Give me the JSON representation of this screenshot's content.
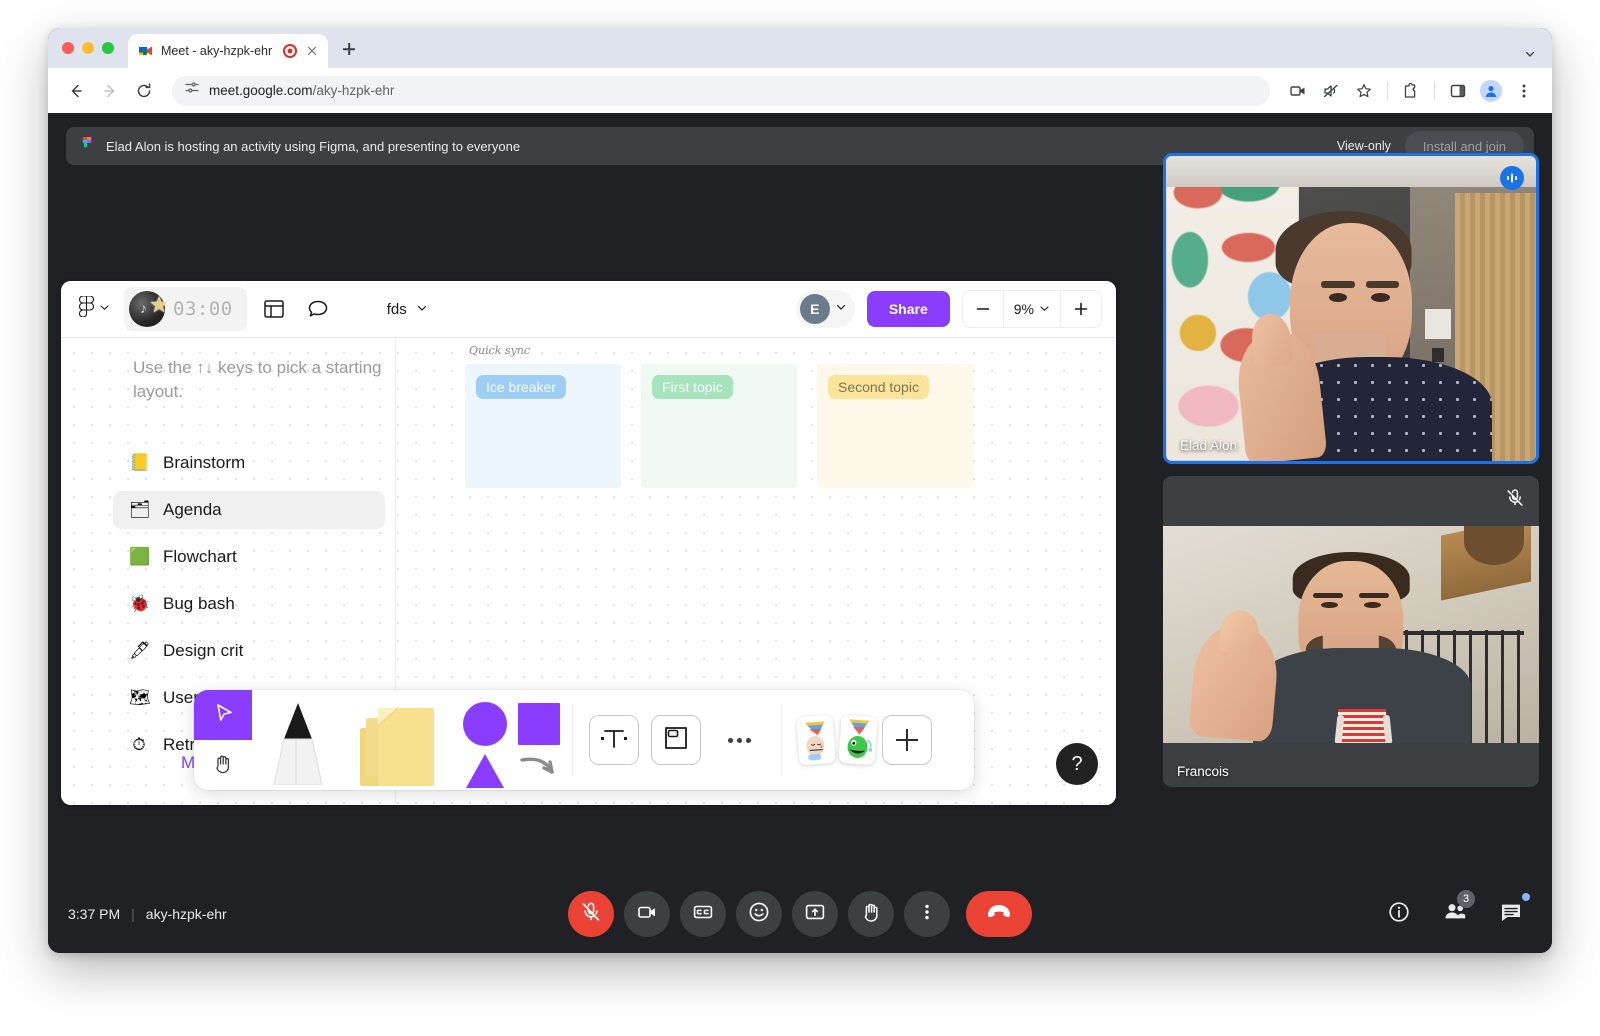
{
  "browser": {
    "tab": {
      "title": "Meet - aky-hzpk-ehr",
      "favicon_icon": "google-meet-favicon",
      "recording_icon": "recording-indicator-icon",
      "close_icon": "close-icon"
    },
    "newtab_icon": "new-tab-icon",
    "tabstrip_caret_icon": "chevron-down-icon",
    "nav": {
      "back_icon": "back-arrow-icon",
      "forward_icon": "forward-arrow-icon",
      "reload_icon": "reload-icon"
    },
    "omnibox": {
      "site_settings_icon": "page-info-icon",
      "url_host": "meet.google.com",
      "url_path": "/aky-hzpk-ehr"
    },
    "actions": [
      {
        "name": "screen-share-icon"
      },
      {
        "name": "mute-tab-icon"
      },
      {
        "name": "bookmark-star-icon"
      },
      {
        "name": "extensions-puzzle-icon"
      },
      {
        "name": "side-panel-icon"
      },
      {
        "name": "profile-avatar-icon"
      },
      {
        "name": "more-menu-icon"
      }
    ]
  },
  "banner": {
    "app_icon": "figma-logo-icon",
    "text": "Elad Alon is hosting an activity using Figma, and presenting to everyone",
    "view_only_label": "View-only",
    "install_button_label": "Install and join"
  },
  "figma": {
    "topbar": {
      "menu_icon": "figma-menu-icon",
      "menu_caret_icon": "chevron-down-icon",
      "timer_value": "03:00",
      "timer_badge_icon": "music-star-badge-icon",
      "layout_grid_icon": "layout-grid-icon",
      "comment_icon": "comment-bubble-icon",
      "file_name": "fds",
      "file_caret_icon": "chevron-down-icon",
      "avatar_initial": "E",
      "avatar_caret_icon": "chevron-down-icon",
      "share_label": "Share",
      "zoom_out_icon": "minus-icon",
      "zoom_value": "9%",
      "zoom_caret_icon": "chevron-down-icon",
      "zoom_in_icon": "plus-icon"
    },
    "canvas": {
      "hint": "Use the ↑↓ keys to pick a starting layout.",
      "layouts": [
        {
          "emoji": "📒",
          "label": "Brainstorm",
          "active": false
        },
        {
          "emoji": "🗂",
          "label": "Agenda",
          "active": true
        },
        {
          "emoji": "🟩",
          "label": "Flowchart",
          "active": false
        },
        {
          "emoji": "🐞",
          "label": "Bug bash",
          "active": false
        },
        {
          "emoji": "🖋",
          "label": "Design crit",
          "active": false
        },
        {
          "emoji": "🗺",
          "label": "User journey",
          "active": false
        },
        {
          "emoji": "⏱",
          "label": "Retro",
          "active": false
        }
      ],
      "more_label": "M",
      "agenda": {
        "title": "Quick sync",
        "columns": [
          {
            "label": "Ice breaker",
            "color": "#9ecdf6"
          },
          {
            "label": "First topic",
            "color": "#a7e3bd"
          },
          {
            "label": "Second topic",
            "color": "#f9e49a"
          }
        ]
      }
    },
    "toolbar": {
      "items": [
        {
          "name": "cursor-tool",
          "label": "cursor-arrow-icon"
        },
        {
          "name": "hand-tool",
          "label": "hand-icon"
        },
        {
          "name": "pen-tool",
          "label": "marker-pen-icon"
        },
        {
          "name": "sticky-note-tool",
          "label": "sticky-notes-icon"
        },
        {
          "name": "shapes-tool",
          "label": "shapes-icon"
        },
        {
          "name": "text-tool",
          "label": "text-T-icon"
        },
        {
          "name": "section-tool",
          "label": "section-frame-icon"
        },
        {
          "name": "more-tools",
          "label": "ellipsis-icon"
        },
        {
          "name": "sticker-party-face",
          "label": "party-face-sticker-icon"
        },
        {
          "name": "sticker-party-monster",
          "label": "party-monster-sticker-icon"
        },
        {
          "name": "add-sticker",
          "label": "plus-icon"
        }
      ]
    },
    "help_label": "?"
  },
  "participants": [
    {
      "name": "Elad Alon",
      "badge": "speaking-indicator-icon",
      "speaking": true,
      "muted": false
    },
    {
      "name": "Francois",
      "badge": "mic-muted-icon",
      "speaking": false,
      "muted": true
    }
  ],
  "meetbar": {
    "time": "3:37 PM",
    "separator": "|",
    "meeting_code": "aky-hzpk-ehr",
    "controls": [
      {
        "name": "microphone-muted-button",
        "icon": "mic-off-icon",
        "state": "danger"
      },
      {
        "name": "camera-button",
        "icon": "video-camera-icon",
        "state": "normal"
      },
      {
        "name": "captions-button",
        "icon": "closed-captions-icon",
        "state": "normal"
      },
      {
        "name": "emoji-reactions-button",
        "icon": "smiley-face-icon",
        "state": "normal"
      },
      {
        "name": "present-screen-button",
        "icon": "present-screen-icon",
        "state": "normal"
      },
      {
        "name": "raise-hand-button",
        "icon": "raised-hand-icon",
        "state": "normal"
      },
      {
        "name": "more-options-button",
        "icon": "three-dots-vertical-icon",
        "state": "normal"
      },
      {
        "name": "leave-call-button",
        "icon": "hang-up-phone-icon",
        "state": "hangup"
      }
    ],
    "right": {
      "info_icon": "info-circle-icon",
      "people_icon": "people-icon",
      "people_count": "3",
      "chat_icon": "chat-bubble-icon"
    }
  },
  "colors": {
    "meet_bg": "#202124",
    "surface": "#3c4043",
    "accent_blue": "#1a73e8",
    "danger_red": "#ea4335",
    "figma_purple": "#8b3dff"
  }
}
